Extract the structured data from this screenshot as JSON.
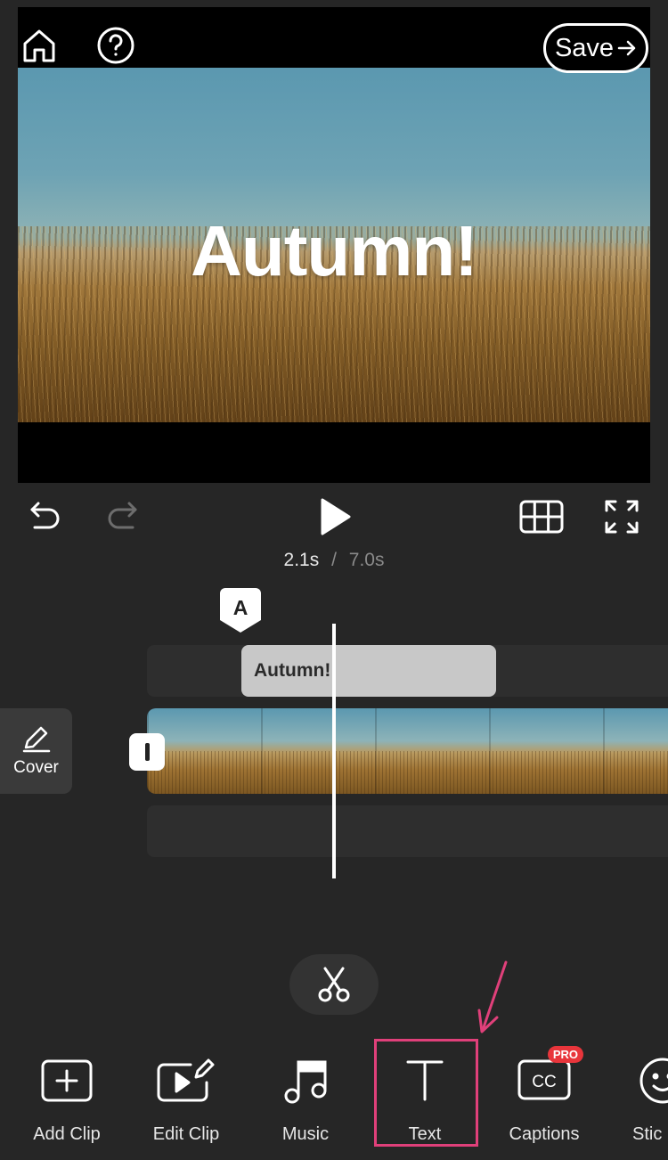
{
  "preview": {
    "overlay_text": "Autumn!",
    "save_label": "Save"
  },
  "playback": {
    "current_time": "2.1s",
    "separator": "/",
    "total_time": "7.0s"
  },
  "timeline": {
    "text_marker": "A",
    "text_clip_label": "Autumn!",
    "cover_label": "Cover"
  },
  "toolbar": {
    "items": [
      {
        "label": "Add Clip",
        "icon": "add-clip-icon"
      },
      {
        "label": "Edit Clip",
        "icon": "edit-clip-icon"
      },
      {
        "label": "Music",
        "icon": "music-icon"
      },
      {
        "label": "Text",
        "icon": "text-icon",
        "highlighted": true
      },
      {
        "label": "Captions",
        "icon": "captions-icon",
        "badge": "PRO"
      },
      {
        "label": "Stic",
        "icon": "stickers-icon"
      }
    ]
  },
  "colors": {
    "background": "#262626",
    "highlight": "#e0407a",
    "pro_badge": "#e8353b"
  }
}
